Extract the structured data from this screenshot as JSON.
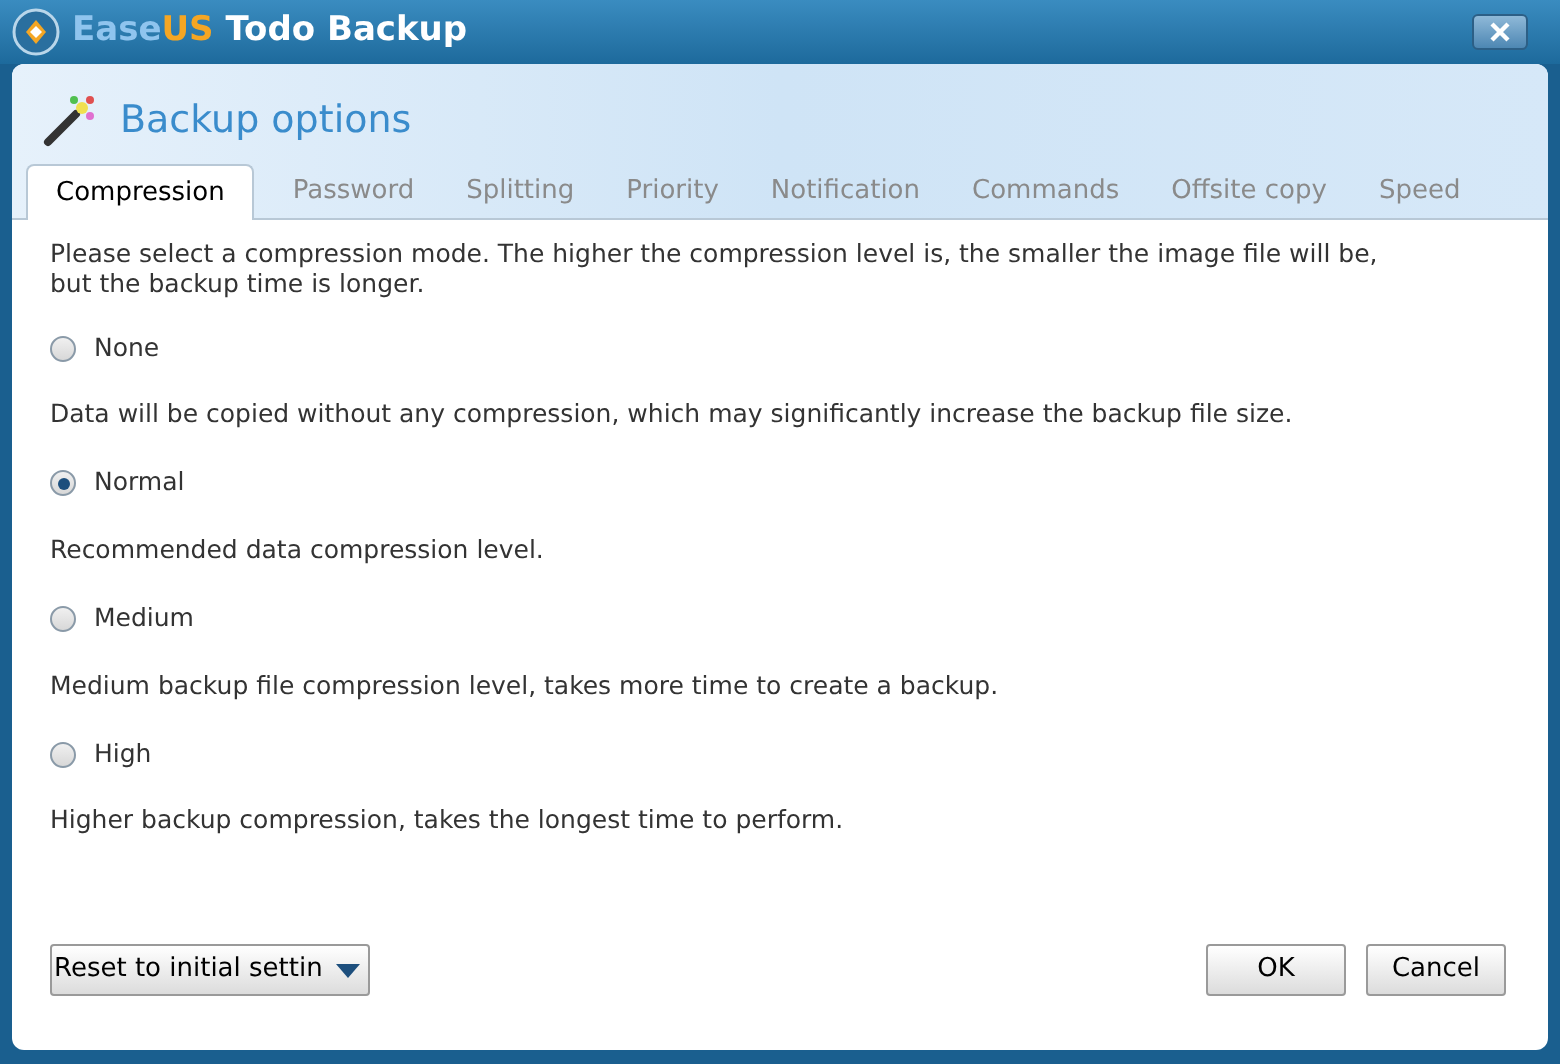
{
  "window": {
    "title_parts": [
      {
        "text": "Ease",
        "color": "#8fc4ee"
      },
      {
        "text": "US",
        "color": "#f5a623"
      },
      {
        "text": " Todo Backup",
        "color": "#ffffff"
      }
    ]
  },
  "header": {
    "title": "Backup options"
  },
  "tabs": [
    {
      "label": "Compression",
      "selected": true
    },
    {
      "label": "Password",
      "selected": false
    },
    {
      "label": "Splitting",
      "selected": false
    },
    {
      "label": "Priority",
      "selected": false
    },
    {
      "label": "Notification",
      "selected": false
    },
    {
      "label": "Commands",
      "selected": false
    },
    {
      "label": "Offsite copy",
      "selected": false
    },
    {
      "label": "Speed",
      "selected": false
    }
  ],
  "intro": "Please select a compression mode. The higher the compression level is, the smaller the image file will be, but the backup time is longer.",
  "modes": [
    {
      "label": "None",
      "selected": false,
      "description": "Data will be copied without any compression, which may significantly increase the backup file size."
    },
    {
      "label": "Normal",
      "selected": true,
      "description": "Recommended data compression level."
    },
    {
      "label": "Medium",
      "selected": false,
      "description": "Medium backup file compression level, takes more time to create a backup."
    },
    {
      "label": "High",
      "selected": false,
      "description": "Higher backup compression, takes the longest time to perform."
    }
  ],
  "buttons": {
    "reset": "Reset to initial settin",
    "ok": "OK",
    "cancel": "Cancel"
  }
}
